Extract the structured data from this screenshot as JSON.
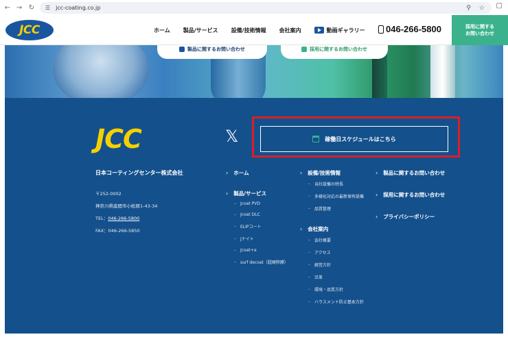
{
  "browser": {
    "url": "jcc-coating.co.jp"
  },
  "header": {
    "logo": "JCC",
    "nav": [
      {
        "label": "ホーム"
      },
      {
        "label": "製品/サービス"
      },
      {
        "label": "設備/技術情報"
      },
      {
        "label": "会社案内"
      },
      {
        "label": "動画ギャラリー"
      }
    ],
    "phone": "046-266-5800",
    "recruit_line1": "採用に関する",
    "recruit_line2": "お問い合わせ"
  },
  "hero": {
    "card_left": "製品に関するお問い合わせ",
    "card_right": "採用に関するお問い合わせ"
  },
  "footer": {
    "logo": "JCC",
    "schedule_button": "稼働日スケジュールはこちら",
    "company_name": "日本コーティングセンター株式会社",
    "postal": "〒252-0002",
    "address": "神奈川県座間市小松原1-43-34",
    "tel_label": "TEL：",
    "tel": "046-266-5800",
    "fax": "FAX：046-266-5850",
    "col1": {
      "home": "ホーム",
      "products": "製品/サービス",
      "product_items": [
        "Jcoat PVD",
        "Jcoat DLC",
        "ELIPコート",
        "Jナイト",
        "Jcoat+α",
        "surf decoat（超硬除膜）"
      ]
    },
    "col2": {
      "equipment": "設備/技術情報",
      "equipment_items": [
        "当社設備の特長",
        "多様化対応の最新保有設備",
        "品質管理"
      ],
      "company": "会社案内",
      "company_items": [
        "会社概要",
        "アクセス",
        "経営方針",
        "沿革",
        "環境・品質方針",
        "ハラスメント防止基本方針"
      ]
    },
    "col3": {
      "items": [
        "製品に関するお問い合わせ",
        "採用に関するお問い合わせ",
        "プライバシーポリシー"
      ]
    }
  }
}
